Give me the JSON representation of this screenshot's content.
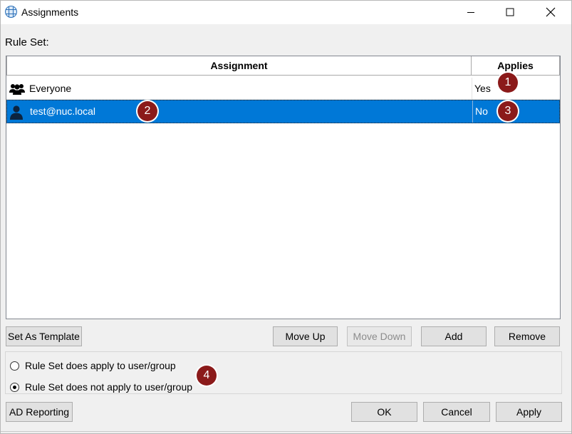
{
  "window": {
    "title": "Assignments",
    "icon": "grid-app-icon"
  },
  "rule_set_label": "Rule Set:",
  "table": {
    "columns": [
      "Assignment",
      "Applies"
    ],
    "rows": [
      {
        "icon": "group-icon",
        "name": "Everyone",
        "applies": "Yes",
        "selected": false
      },
      {
        "icon": "user-icon",
        "name": "test@nuc.local",
        "applies": "No",
        "selected": true
      }
    ]
  },
  "badges": [
    "1",
    "2",
    "3",
    "4"
  ],
  "buttons": {
    "set_as_template": "Set As Template",
    "move_up": "Move Up",
    "move_down": "Move Down",
    "add": "Add",
    "remove": "Remove",
    "ad_reporting": "AD Reporting",
    "ok": "OK",
    "cancel": "Cancel",
    "apply": "Apply"
  },
  "radios": [
    {
      "label": "Rule Set does apply to user/group",
      "checked": false
    },
    {
      "label": "Rule Set does not apply to user/group",
      "checked": true
    }
  ],
  "colors": {
    "selection": "#0078d7",
    "badge": "#8b1a1a"
  }
}
